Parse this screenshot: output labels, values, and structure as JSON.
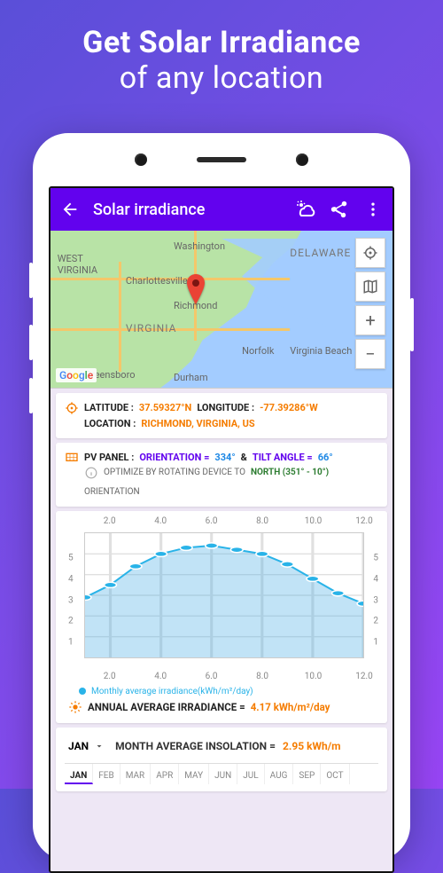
{
  "promo": {
    "line1": "Get Solar Irradiance",
    "line2": "of any location"
  },
  "appbar": {
    "title": "Solar irradiance"
  },
  "map": {
    "labels": {
      "washington": "Washington",
      "delaware": "DELAWARE",
      "wv": "WEST\nVIRGINIA",
      "charlottesville": "Charlottesville",
      "richmond": "Richmond",
      "virginia": "VIRGINIA",
      "norfolk": "Norfolk",
      "vbeach": "Virginia Beach",
      "greensboro": "Greensboro",
      "durham": "Durham"
    },
    "google": [
      "G",
      "o",
      "o",
      "g",
      "l",
      "e"
    ]
  },
  "coords": {
    "lat_label": "LATITUDE :",
    "lat_value": "37.59327°N",
    "lon_label": "LONGITUDE :",
    "lon_value": "-77.39286°W",
    "loc_label": "LOCATION :",
    "loc_value": "RICHMOND, VIRGINIA, US"
  },
  "panel": {
    "title": "PV PANEL :",
    "orient_label": "ORIENTATION =",
    "orient_value": "334°",
    "amp": "&",
    "tilt_label": "TILT ANGLE =",
    "tilt_value": "66°",
    "hint_pre": "OPTIMIZE BY ROTATING DEVICE TO",
    "hint_dir": "NORTH (351° - 10°)",
    "hint_post": "ORIENTATION"
  },
  "chart_data": {
    "type": "line",
    "x": [
      1,
      2,
      3,
      4,
      5,
      6,
      7,
      8,
      9,
      10,
      11,
      12
    ],
    "values": [
      2.9,
      3.5,
      4.4,
      5.0,
      5.3,
      5.4,
      5.2,
      5.0,
      4.5,
      3.8,
      3.1,
      2.6
    ],
    "ylim": [
      0,
      6
    ],
    "xticks": [
      2,
      4,
      6,
      8,
      10,
      12
    ],
    "yticks": [
      1,
      2,
      3,
      4,
      5
    ],
    "legend": "Monthly average irradiance(kWh/m²/day)",
    "annual_label": "ANNUAL AVERAGE IRRADIANCE  =",
    "annual_value": "4.17 kWh/m²/day"
  },
  "month": {
    "selected": "JAN",
    "label": "MONTH AVERAGE INSOLATION =",
    "value": "2.95 kWh/m",
    "tabs": [
      "JAN",
      "FEB",
      "MAR",
      "APR",
      "MAY",
      "JUN",
      "JUL",
      "AUG",
      "SEP",
      "OCT"
    ]
  }
}
